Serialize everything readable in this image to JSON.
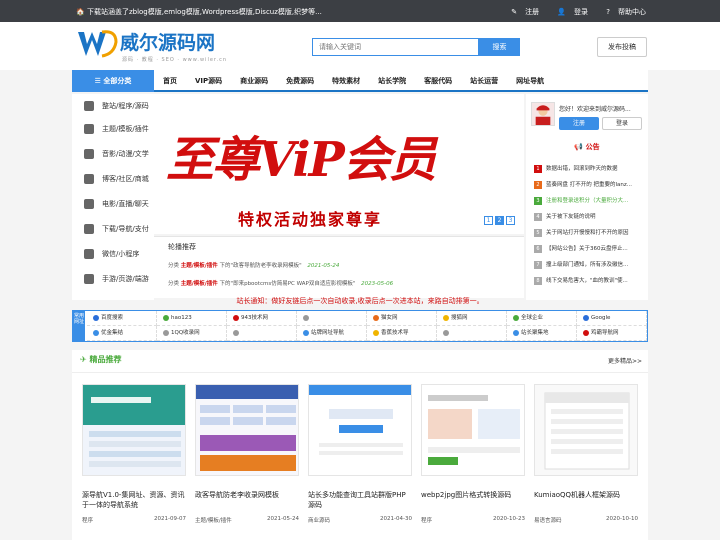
{
  "topbar": {
    "notice": "下载站涵盖了zblog模版,emlog模版,Wordpress模版,Discuz模版,织梦等...",
    "links": [
      "注册",
      "登录",
      "帮助中心"
    ]
  },
  "header": {
    "logo_text": "威尔源码网",
    "logo_sub": "源码 · 教程 · SEO · www.wiler.cn",
    "search_placeholder": "请输入关键词",
    "search_button": "搜索",
    "post_button": "发布投稿"
  },
  "nav": {
    "all_label": "全部分类",
    "items": [
      "首页",
      "VIP源码",
      "商业源码",
      "免费源码",
      "特效素材",
      "站长学院",
      "客服代码",
      "站长运营",
      "网址导航"
    ]
  },
  "sidebar": {
    "items": [
      "整站/程序/源码",
      "主题/模板/插件",
      "音影/动漫/文学",
      "博客/社区/商城",
      "电影/直播/聊天",
      "下载/导航/支付",
      "微信/小程序",
      "手游/页游/端游"
    ]
  },
  "banner": {
    "headline": "至尊ViP会员",
    "tagline": "特权活动独家尊享",
    "dots": [
      "1",
      "2",
      "3"
    ],
    "active_dot": 1
  },
  "recommend": {
    "title": "轮播推荐",
    "rows": [
      {
        "prefix": "分类",
        "cat": "主题/模板/插件",
        "text": "下的\"政客导航防老李收录网模板\"",
        "date": "2021-05-24"
      },
      {
        "prefix": "分类",
        "cat": "主题/模板/插件",
        "text": "下的\"即来pbootcms仿简易PC WAP双自适应影视模板\"",
        "date": "2023-05-06"
      }
    ]
  },
  "user": {
    "welcome": "您好！欢迎来到威尔源码...",
    "register": "注册",
    "login": "登录",
    "announce_title": "公告",
    "news": [
      {
        "n": "1",
        "text": "数据出错，回滚到昨天的数据",
        "color": "#d10e0e"
      },
      {
        "n": "2",
        "text": "蓝奏网盘 打不开的 把重要的lanz...",
        "color": "#e86a1a"
      },
      {
        "n": "3",
        "text": "注册和登录送积分（大量积分大...",
        "color": "#4aaa3c"
      },
      {
        "n": "4",
        "text": "关于被下友链的说明",
        "color": "#999999"
      },
      {
        "n": "5",
        "text": "关于网站打开慢慢和打不开的原因",
        "color": "#999999"
      },
      {
        "n": "6",
        "text": "【网站公告】关于360云盘停止...",
        "color": "#999999"
      },
      {
        "n": "7",
        "text": "撞上级部门通知，所有涉及徽信...",
        "color": "#999999"
      },
      {
        "n": "8",
        "text": "线下交易危害大，\"血的教训\"使...",
        "color": "#999999"
      }
    ]
  },
  "marquee": "站长通知：做好友链后点一次自动收录,收录后点一次进本站，来路自动排第一。",
  "linkbox": {
    "label": "常用网址",
    "links": [
      {
        "text": "百度搜索",
        "color": "#2b6ed9"
      },
      {
        "text": "hao123",
        "color": "#4aaa3c"
      },
      {
        "text": "943技术网",
        "color": "#d10e0e"
      },
      {
        "text": "",
        "color": "#999999"
      },
      {
        "text": "猫女网",
        "color": "#e86a1a"
      },
      {
        "text": "搜狐网",
        "color": "#f0b400"
      },
      {
        "text": "全球企业",
        "color": "#4aaa3c"
      },
      {
        "text": "Google",
        "color": "#2b6ed9"
      },
      {
        "text": "优金集结",
        "color": "#3a8ee6"
      },
      {
        "text": "1QQ收录网",
        "color": "#999999"
      },
      {
        "text": "",
        "color": "#999999"
      },
      {
        "text": "站牌网址导航",
        "color": "#3a8ee6"
      },
      {
        "text": "香蕉技术导",
        "color": "#f0b400"
      },
      {
        "text": "",
        "color": "#999999"
      },
      {
        "text": "站长聚集地",
        "color": "#3a8ee6"
      },
      {
        "text": "鸡霸导航网",
        "color": "#d10e0e"
      }
    ]
  },
  "featured": {
    "title": "精品推荐",
    "more": "更多精品>>",
    "cards": [
      {
        "title": "源导航V1.0-集网址、资源、资讯于一体的导航系统",
        "cat": "程序",
        "date": "2021-09-07"
      },
      {
        "title": "政客导航防老李收录网模板",
        "cat": "主题/模板/插件",
        "date": "2021-05-24"
      },
      {
        "title": "站长多功能查询工具站群版PHP源码",
        "cat": "商业源码",
        "date": "2021-04-30"
      },
      {
        "title": "webp2jpg图片格式转换源码",
        "cat": "程序",
        "date": "2020-10-23"
      },
      {
        "title": "KumiaoQQ机器人框架源码",
        "cat": "易语言源码",
        "date": "2020-10-10"
      }
    ]
  },
  "colors": {
    "brand": "#3a8ee6",
    "accent_red": "#d10e0e",
    "green": "#4aaa3c",
    "topbar": "#3c3f44"
  }
}
